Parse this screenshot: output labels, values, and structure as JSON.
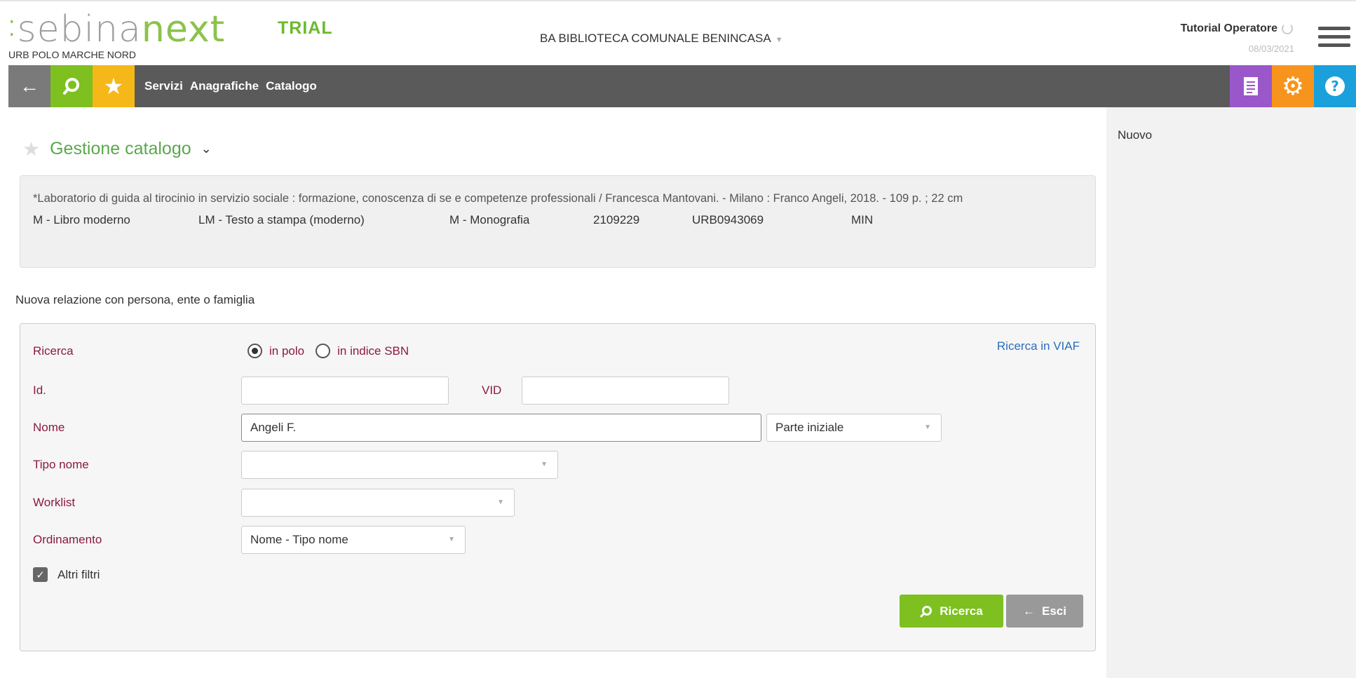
{
  "header": {
    "logo_part1": "sebina",
    "logo_part2": "next",
    "polo": "URB POLO MARCHE NORD",
    "trial": "TRIAL",
    "library": "BA BIBLIOTECA COMUNALE BENINCASA",
    "user": "Tutorial Operatore",
    "date": "08/03/2021"
  },
  "navbar": {
    "links": [
      "Servizi",
      "Anagrafiche",
      "Catalogo"
    ]
  },
  "side": {
    "label": "Nuovo"
  },
  "main": {
    "title": "Gestione catalogo",
    "record": {
      "description": "*Laboratorio di guida al tirocinio in servizio sociale : formazione, conoscenza di se e competenze professionali / Francesca Mantovani. - Milano : Franco Angeli, 2018. - 109 p. ; 22 cm",
      "meta": [
        "M - Libro moderno",
        "LM - Testo a stampa (moderno)",
        "M - Monografia",
        "2109229",
        "URB0943069",
        "MIN"
      ]
    },
    "section_label": "Nuova relazione con persona, ente o famiglia"
  },
  "form": {
    "ricerca_label": "Ricerca",
    "radio_polo": "in polo",
    "radio_indice": "in indice SBN",
    "viaf_link": "Ricerca in VIAF",
    "id_label": "Id.",
    "vid_label": "VID",
    "nome_label": "Nome",
    "nome_value": "Angeli F.",
    "nome_match": "Parte iniziale",
    "tipo_nome_label": "Tipo nome",
    "worklist_label": "Worklist",
    "ordinamento_label": "Ordinamento",
    "ordinamento_value": "Nome - Tipo nome",
    "altri_filtri": "Altri filtri",
    "btn_ricerca": "Ricerca",
    "btn_esci": "Esci"
  }
}
